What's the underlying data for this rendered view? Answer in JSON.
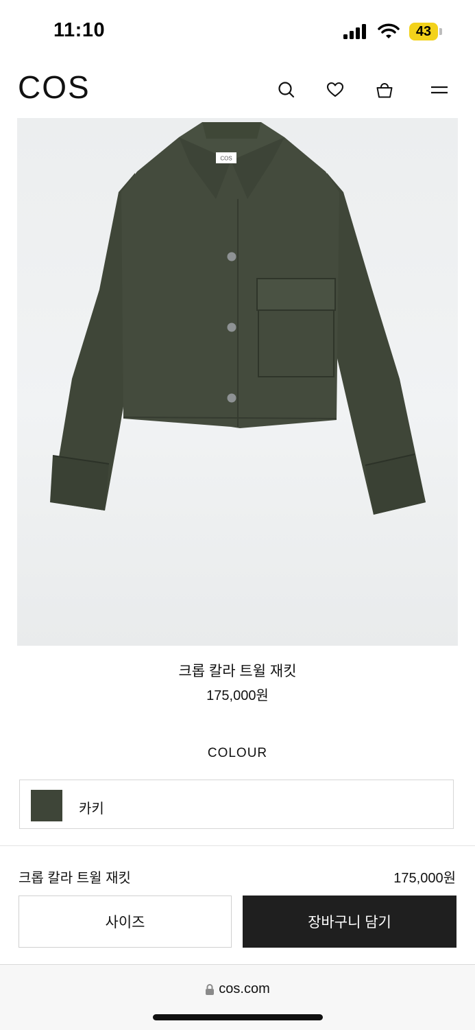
{
  "status_bar": {
    "time": "11:10",
    "battery": "43"
  },
  "header": {
    "logo": "COS"
  },
  "product": {
    "name": "크롭 칼라 트윌 재킷",
    "price": "175,000원",
    "label_text": "COS"
  },
  "colour": {
    "title": "COLOUR",
    "selected": "카키",
    "swatch_color": "#3e4538"
  },
  "purchase_bar": {
    "name": "크롭 칼라 트윌 재킷",
    "price": "175,000원",
    "size_button": "사이즈",
    "cart_button": "장바구니 담기"
  },
  "browser": {
    "url": "cos.com"
  }
}
